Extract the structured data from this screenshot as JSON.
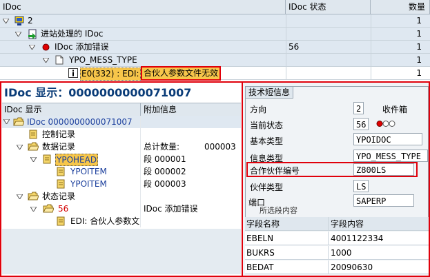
{
  "top_table": {
    "headers": [
      "IDoc",
      "IDoc 状态",
      "数量"
    ],
    "rows": [
      {
        "label": "2",
        "status": "",
        "count": "1"
      },
      {
        "label": "进站处理的 IDoc",
        "status": "",
        "count": "1"
      },
      {
        "label": "IDoc 添加错误",
        "status": "56",
        "count": "1"
      },
      {
        "label": "YPO_MESS_TYPE",
        "status": "",
        "count": "1"
      },
      {
        "label_prefix": "E0(332) : EDI:",
        "label_highlight": "合伙人参数文件无效",
        "status": "",
        "count": "1"
      }
    ]
  },
  "idoc_display": {
    "title": "IDoc 显示：0000000000071007",
    "col_headers": [
      "IDoc 显示",
      "附加信息"
    ],
    "tree": {
      "root": "IDoc 0000000000071007",
      "control": "控制记录",
      "data": "数据记录",
      "data_info_label": "总计数量:",
      "data_info_value": "000003",
      "segments": [
        {
          "name": "YPOHEAD",
          "info": "段 000001"
        },
        {
          "name": "YPOITEM",
          "info": "段 000002"
        },
        {
          "name": "YPOITEM",
          "info": "段 000003"
        }
      ],
      "status_records": "状态记录",
      "status_code": "56",
      "status_info": "IDoc 添加错误",
      "status_message": "EDI: 合伙人参数文"
    }
  },
  "short_info": {
    "tab_label": "技术短信息",
    "fields": [
      {
        "label": "方向",
        "value": "2",
        "extra": "收件箱"
      },
      {
        "label": "当前状态",
        "value": "56"
      },
      {
        "label": "基本类型",
        "value": "YPOIDOC"
      },
      {
        "label": "信息类型",
        "value": "YPO_MESS_TYPE"
      },
      {
        "label": "合作伙伴编号",
        "value": "Z800LS"
      },
      {
        "label": "伙伴类型",
        "value": "LS"
      },
      {
        "label": "端口",
        "value": "SAPERP"
      }
    ],
    "section_label": "所选段内容",
    "grid_headers": [
      "字段名称",
      "字段内容"
    ],
    "grid_rows": [
      {
        "name": "EBELN",
        "value": "4001122334"
      },
      {
        "name": "BUKRS",
        "value": "1000"
      },
      {
        "name": "BEDAT",
        "value": "20090630"
      }
    ]
  },
  "colors": {
    "header_bg": "#dfe7ee",
    "title_blue": "#0a3c78",
    "link_blue": "#1a3e9c",
    "highlight_red": "#e0000b",
    "highlight_yellow": "#f7c64a",
    "status_red": "#d40000",
    "selection_bg": "#dfe8f1"
  }
}
